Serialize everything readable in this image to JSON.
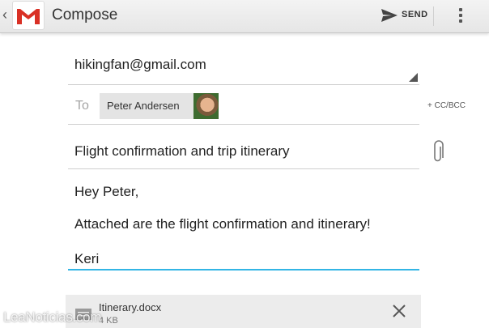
{
  "action_bar": {
    "title": "Compose",
    "send_label": "SEND",
    "icons": [
      "up-caret-icon",
      "gmail-logo",
      "send-icon",
      "overflow-menu-icon"
    ],
    "colors": {
      "gmail_red": "#d93025",
      "bar_bg": "#eeeeee"
    }
  },
  "compose": {
    "from": "hikingfan@gmail.com",
    "to_label": "To",
    "recipients": [
      {
        "name": "Peter Andersen"
      }
    ],
    "cc_bcc_label": "+ CC/BCC",
    "subject": "Flight confirmation and trip itinerary",
    "body_lines": [
      "Hey Peter,",
      "Attached are the flight confirmation and itinerary!",
      "Keri"
    ],
    "focus_color": "#33b5e5"
  },
  "attachment": {
    "filename": "Itinerary.docx",
    "size": "4 KB"
  },
  "watermark": "LeaNoticias.com"
}
